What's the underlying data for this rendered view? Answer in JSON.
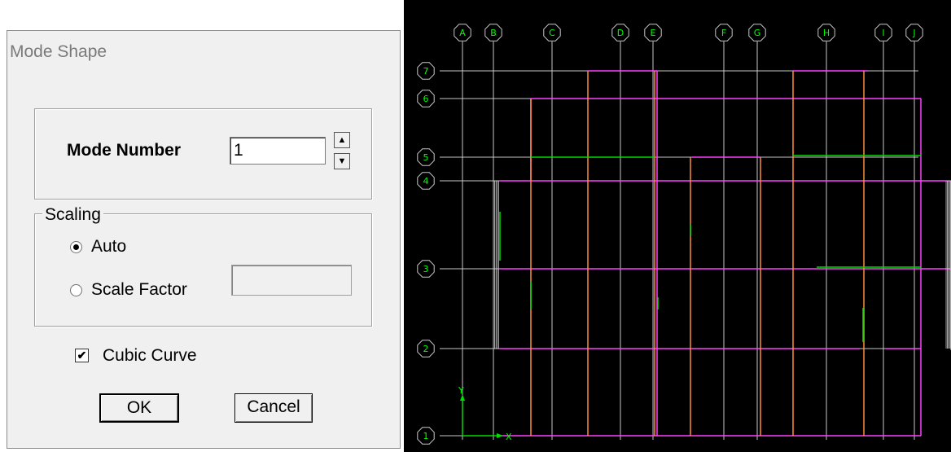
{
  "dialog": {
    "title": "Mode Shape",
    "mode_number": {
      "label": "Mode Number",
      "value": "1"
    },
    "scaling": {
      "legend": "Scaling",
      "options": [
        {
          "label": "Auto",
          "selected": true
        },
        {
          "label": "Scale Factor",
          "selected": false
        }
      ],
      "scale_factor_value": ""
    },
    "cubic_curve": {
      "label": "Cubic Curve",
      "checked": true
    },
    "buttons": {
      "ok": "OK",
      "cancel": "Cancel"
    },
    "icons": {
      "spin_up": "spin-up-arrow-icon",
      "spin_down": "spin-down-arrow-icon",
      "check": "checkmark-icon"
    }
  },
  "plan": {
    "grid_x_labels": [
      "A",
      "B",
      "C",
      "D",
      "E",
      "F",
      "G",
      "H",
      "I",
      "J"
    ],
    "grid_y_labels": [
      "1",
      "2",
      "3",
      "4",
      "5",
      "6",
      "7"
    ],
    "axis": {
      "x": "X",
      "y": "Y"
    },
    "colors": {
      "background": "#000000",
      "grid": "#c8c8c8",
      "label": "#00ff00",
      "deformed_beam": "#ff40ff",
      "deformed_column": "#ff8c3c",
      "green_member": "#00dd00"
    }
  }
}
